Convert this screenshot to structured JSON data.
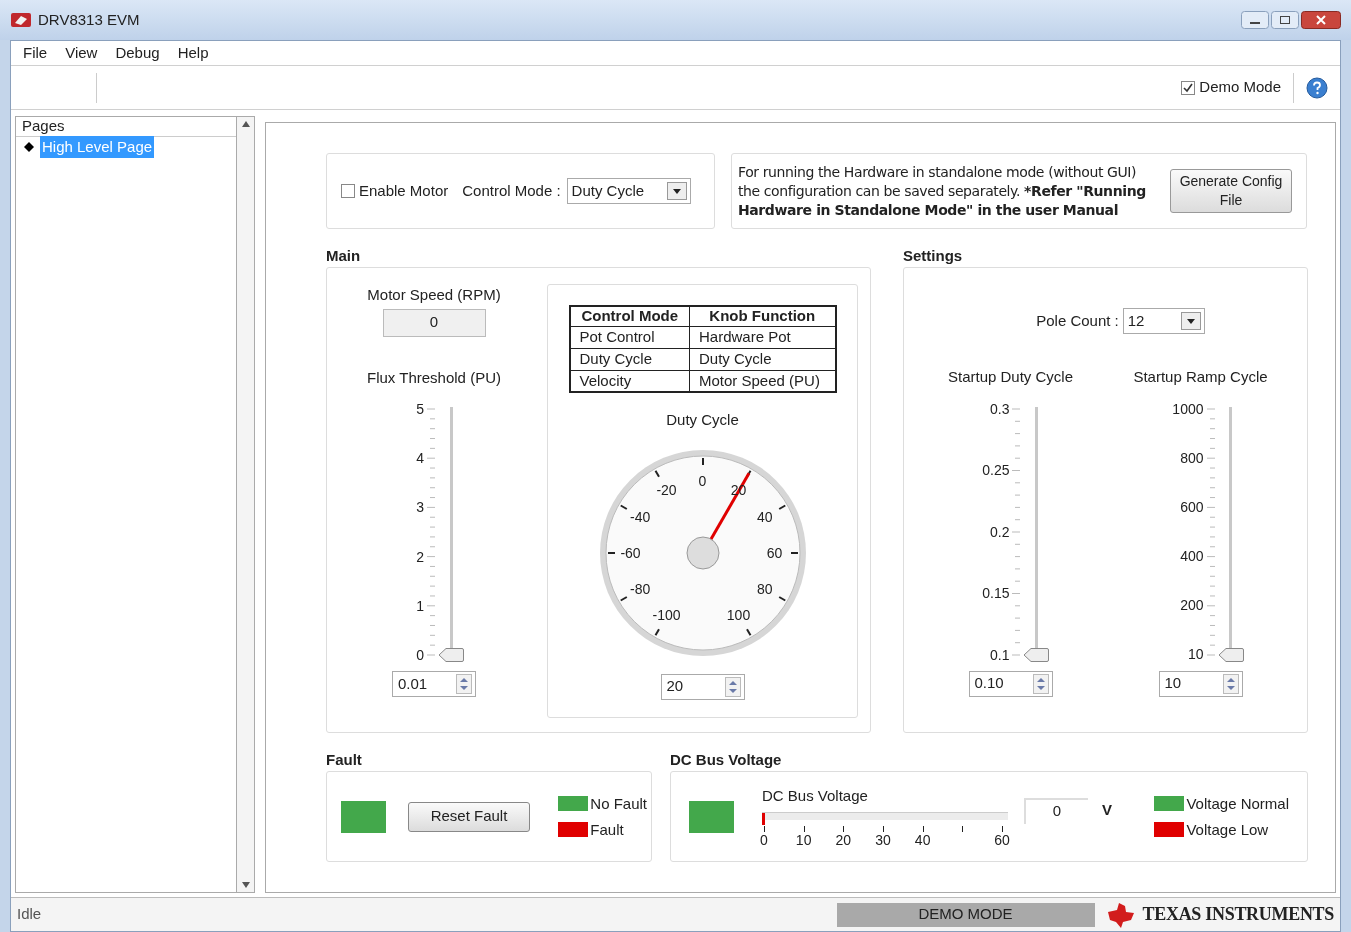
{
  "window": {
    "title": "DRV8313 EVM"
  },
  "menu": [
    "File",
    "View",
    "Debug",
    "Help"
  ],
  "toolbar": {
    "demo_mode": {
      "label": "Demo Mode",
      "checked": true
    }
  },
  "sidebar": {
    "title": "Pages",
    "items": [
      {
        "label": "High Level Page",
        "selected": true
      }
    ]
  },
  "controls": {
    "enable_motor": {
      "label": "Enable Motor",
      "checked": false
    },
    "control_mode": {
      "label": "Control Mode :",
      "value": "Duty Cycle"
    }
  },
  "info": {
    "text": "For running the Hardware in standalone mode (without GUI) the configuration can be saved separately. ***Refer \"Running Hardware in Standalone Mode\" in the user Manual**",
    "button": "Generate Config File"
  },
  "main": {
    "title": "Main",
    "motor_speed": {
      "label": "Motor Speed (RPM)",
      "value": "0"
    },
    "flux_threshold": {
      "label": "Flux Threshold (PU)",
      "ticks": [
        "5",
        "4",
        "3",
        "2",
        "1",
        "0"
      ],
      "level": 0.002,
      "value": "0.01"
    },
    "table": {
      "columns": [
        "Control Mode",
        "Knob Function"
      ],
      "rows": [
        [
          "Pot Control",
          "Hardware Pot"
        ],
        [
          "Duty Cycle",
          "Duty Cycle"
        ],
        [
          "Velocity",
          "Motor Speed (PU)"
        ]
      ]
    },
    "gauge": {
      "label": "Duty Cycle",
      "ticks": [
        "-100",
        "-80",
        "-60",
        "-40",
        "-20",
        "0",
        "20",
        "40",
        "60",
        "80",
        "100"
      ],
      "value": "20"
    }
  },
  "settings": {
    "title": "Settings",
    "pole_count": {
      "label": "Pole Count :",
      "value": "12"
    },
    "sliders": [
      {
        "label": "Startup Duty Cycle",
        "ticks": [
          "0.3",
          "0.25",
          "0.2",
          "0.15",
          "0.1"
        ],
        "level": 0,
        "value": "0.10"
      },
      {
        "label": "Startup Ramp Cycle",
        "ticks": [
          "1000",
          "800",
          "600",
          "400",
          "200",
          "10"
        ],
        "level": 0,
        "value": "10"
      }
    ]
  },
  "fault": {
    "title": "Fault",
    "indicator": {
      "color": "#43a84b"
    },
    "button": "Reset Fault",
    "legend": [
      {
        "label": "No Fault",
        "color": "#43a84b"
      },
      {
        "label": "Fault",
        "color": "#e00000"
      }
    ]
  },
  "dc_bus": {
    "title": "DC Bus Voltage",
    "indicator": {
      "color": "#43a84b"
    },
    "meter": {
      "label": "DC Bus Voltage",
      "level": 0,
      "ticks": [
        {
          "kind": "labeled",
          "label": "0"
        },
        {
          "kind": "labeled",
          "label": "10"
        },
        {
          "kind": "labeled",
          "label": "20"
        },
        {
          "kind": "labeled",
          "label": "30"
        },
        {
          "kind": "labeled",
          "label": "40"
        },
        {
          "kind": "unlabeled"
        },
        {
          "kind": "labeled",
          "label": "60"
        }
      ],
      "value": "0",
      "unit": "V"
    },
    "legend": [
      {
        "label": "Voltage Normal",
        "color": "#43a84b"
      },
      {
        "label": "Voltage Low",
        "color": "#e00000"
      }
    ]
  },
  "status_bar": {
    "status": "Idle",
    "mode": "DEMO MODE",
    "brand": "TEXAS INSTRUMENTS"
  }
}
